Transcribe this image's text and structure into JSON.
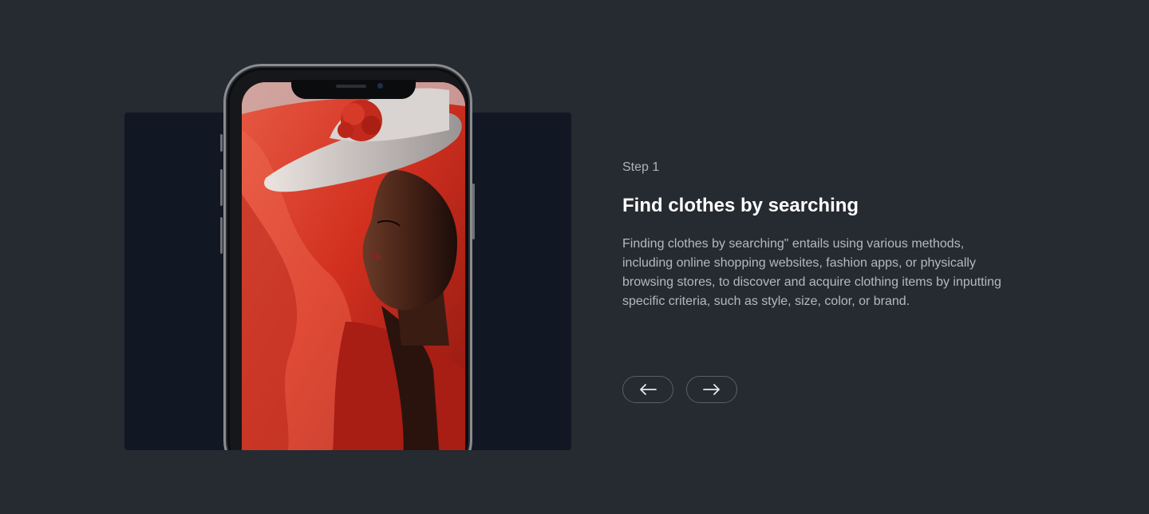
{
  "step": {
    "label": "Step 1",
    "title": "Find clothes by searching",
    "description": "Finding clothes by searching\" entails using various methods, including online shopping websites, fashion apps, or physically browsing stores, to discover and acquire clothing items by inputting specific criteria, such as style, size, color, or brand."
  },
  "navigation": {
    "prev_icon": "arrow-left-icon",
    "next_icon": "arrow-right-icon"
  },
  "colors": {
    "background": "#262a31",
    "panel": "#111723",
    "accent_red": "#c42d1f"
  }
}
